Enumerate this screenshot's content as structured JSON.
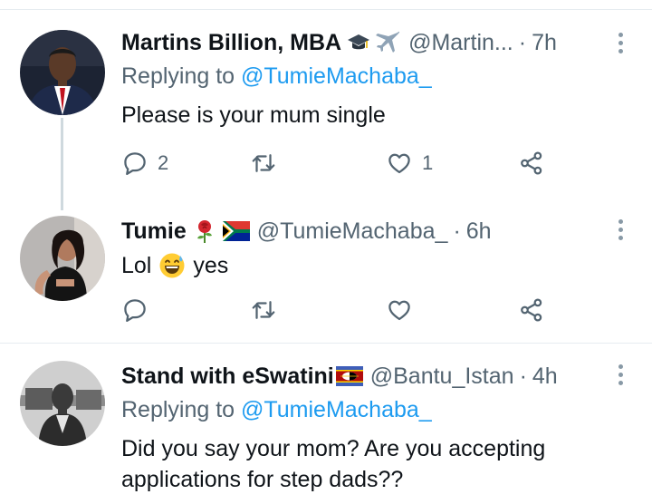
{
  "tweets": [
    {
      "name": "Martins Billion, MBA",
      "emojis": [
        "graduation-cap-icon",
        "airplane-icon"
      ],
      "handle": "@Martin...",
      "separator": "·",
      "time": "7h",
      "replying_prefix": "Replying to",
      "replying_to": "@TumieMachaba_",
      "text": "Please is your mum single",
      "reply_count": "2",
      "retweet_count": "",
      "like_count": "1"
    },
    {
      "name": "Tumie",
      "emojis": [
        "rose-icon",
        "south-africa-flag-icon"
      ],
      "handle": "@TumieMachaba_",
      "separator": "·",
      "time": "6h",
      "text_before": "Lol",
      "text_emoji": "grinning-sweat-face-icon",
      "text_after": "yes",
      "reply_count": "",
      "retweet_count": "",
      "like_count": ""
    },
    {
      "name": "Stand with eSwatini",
      "emojis": [
        "eswatini-flag-icon"
      ],
      "handle": "@Bantu_Istan",
      "separator": "·",
      "time": "4h",
      "replying_prefix": "Replying to",
      "replying_to": "@TumieMachaba_",
      "text_line1": "Did you say your mom? Are you accepting",
      "text_line2": "applications for step dads??"
    }
  ],
  "colors": {
    "text": "#0f1419",
    "secondary": "#536471",
    "link": "#1d9bf0",
    "divider": "#e6ecf0",
    "thread_line": "#cfd9de"
  }
}
